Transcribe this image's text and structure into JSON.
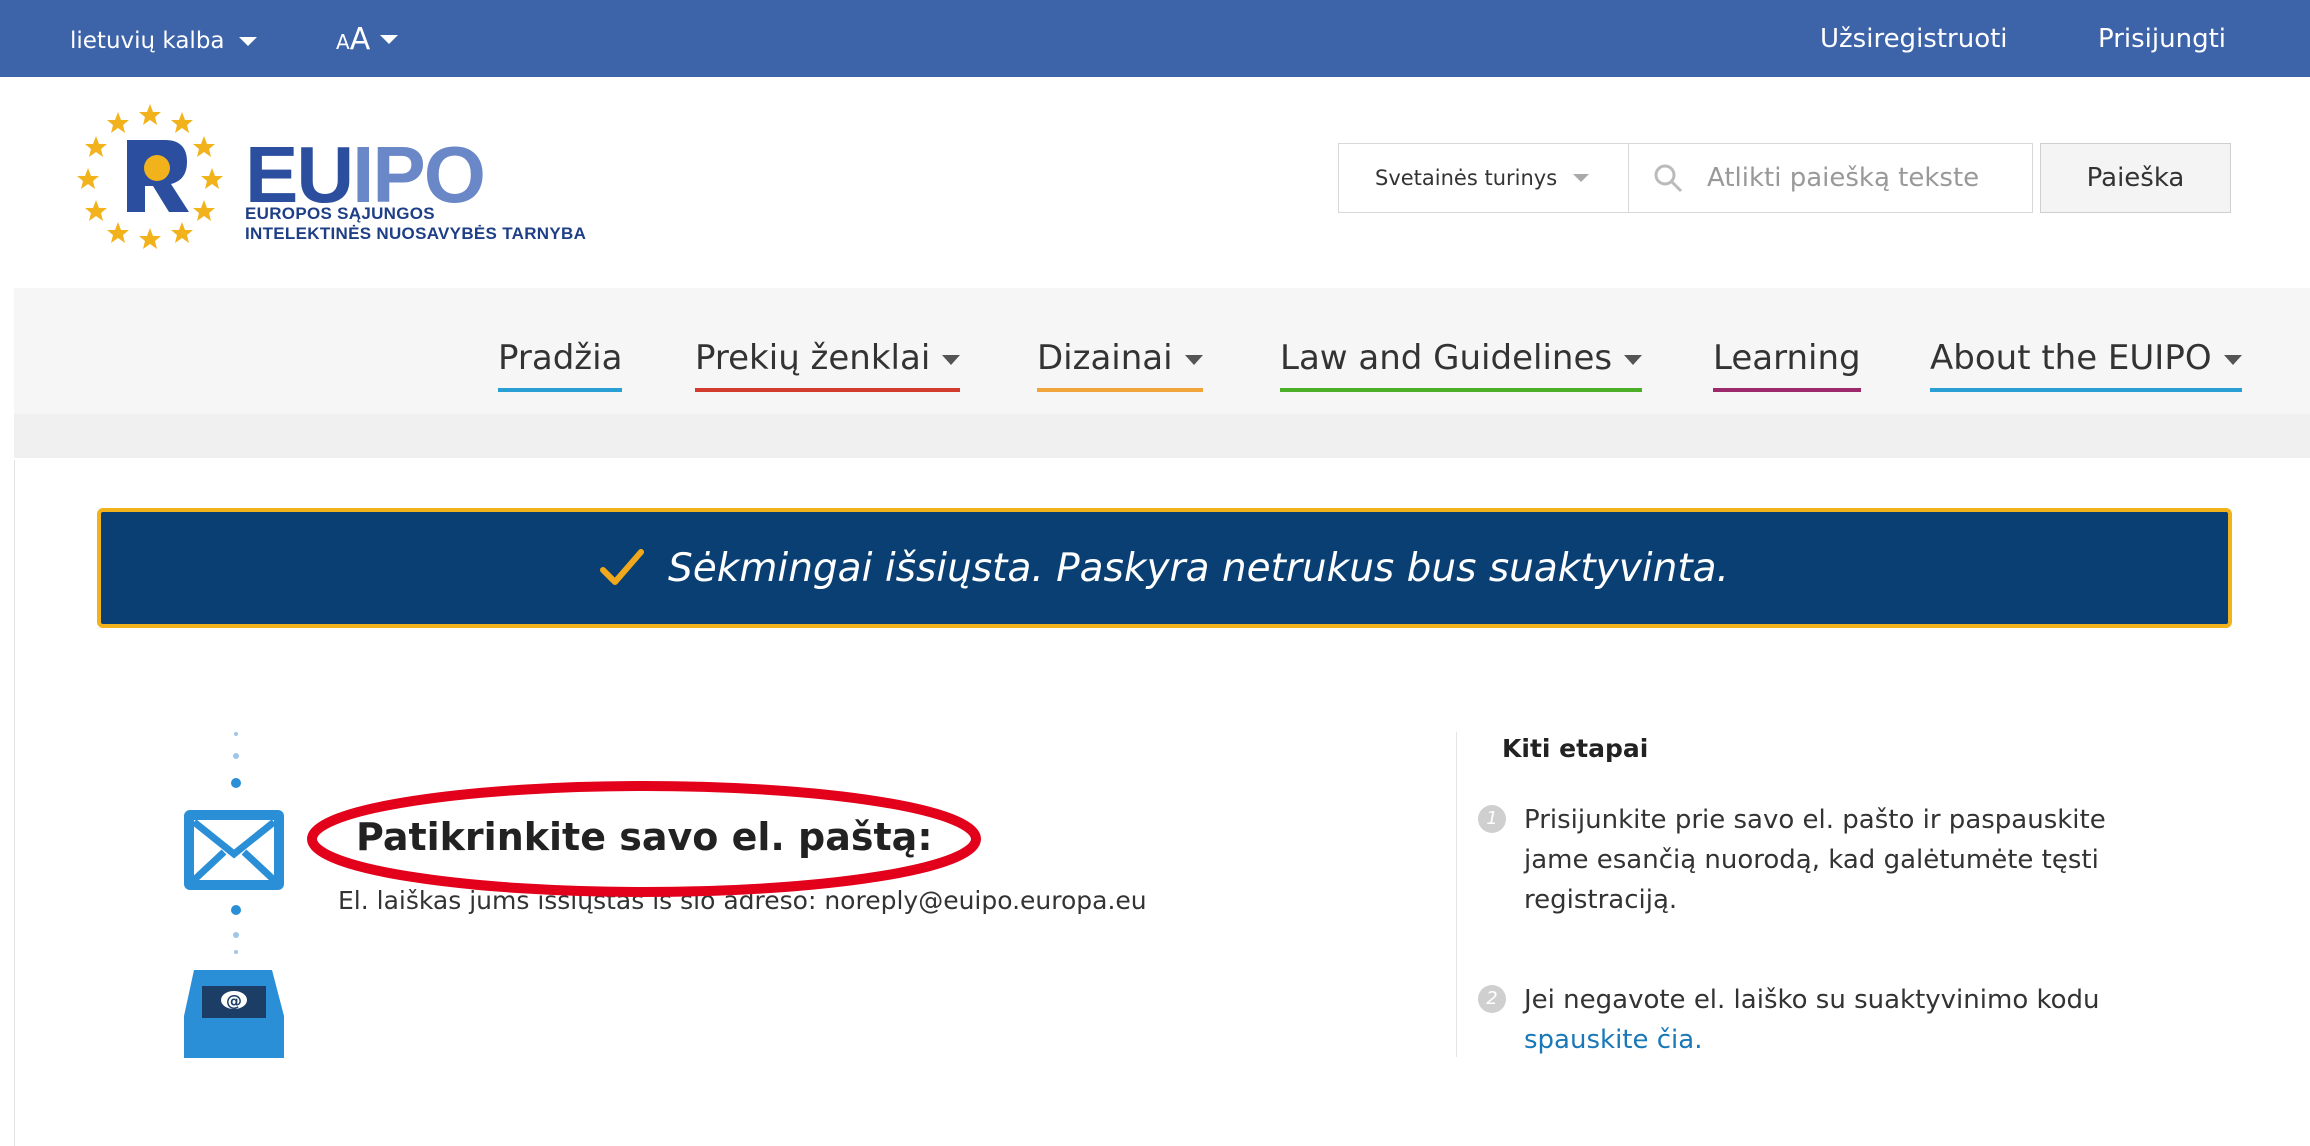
{
  "topbar": {
    "language": "lietuvių kalba",
    "font_size_label_small": "A",
    "font_size_label_large": "A",
    "register": "Užsiregistruoti",
    "login": "Prisijungti"
  },
  "logo": {
    "eu": "EU",
    "ipo": "IPO",
    "subtitle_line1": "EUROPOS SĄJUNGOS",
    "subtitle_line2": "INTELEKTINĖS NUOSAVYBĖS TARNYBA"
  },
  "search": {
    "scope": "Svetainės turinys",
    "placeholder": "Atlikti paiešką tekste",
    "button": "Paieška"
  },
  "nav": {
    "items": [
      {
        "label": "Pradžia",
        "color": "#2a9fd6"
      },
      {
        "label": "Prekių ženklai",
        "color": "#d43b2f"
      },
      {
        "label": "Dizainai",
        "color": "#f0a43a"
      },
      {
        "label": "Law and Guidelines",
        "color": "#4caf28"
      },
      {
        "label": "Learning",
        "color": "#9c2a6b"
      },
      {
        "label": "About the EUIPO",
        "color": "#2a9fd6"
      }
    ]
  },
  "banner": {
    "message": "Sėkmingai išsiųsta. Paskyra netrukus bus suaktyvinta.",
    "background": "#0a3f73",
    "border": "#f2b21c"
  },
  "main": {
    "title": "Patikrinkite savo el. paštą:",
    "text": "El. laiškas jums išsiųstas iš šio adreso: noreply@euipo.europa.eu"
  },
  "next_steps": {
    "title": "Kiti etapai",
    "steps": [
      {
        "num": "1",
        "line1": "Prisijunkite prie savo el. pašto ir paspauskite",
        "line2": "jame esančią nuorodą, kad galėtumėte tęsti",
        "line3": "registraciją."
      },
      {
        "num": "2",
        "line1": "Jei negavote el. laiško su suaktyvinimo kodu",
        "link": "spauskite čia."
      }
    ]
  }
}
